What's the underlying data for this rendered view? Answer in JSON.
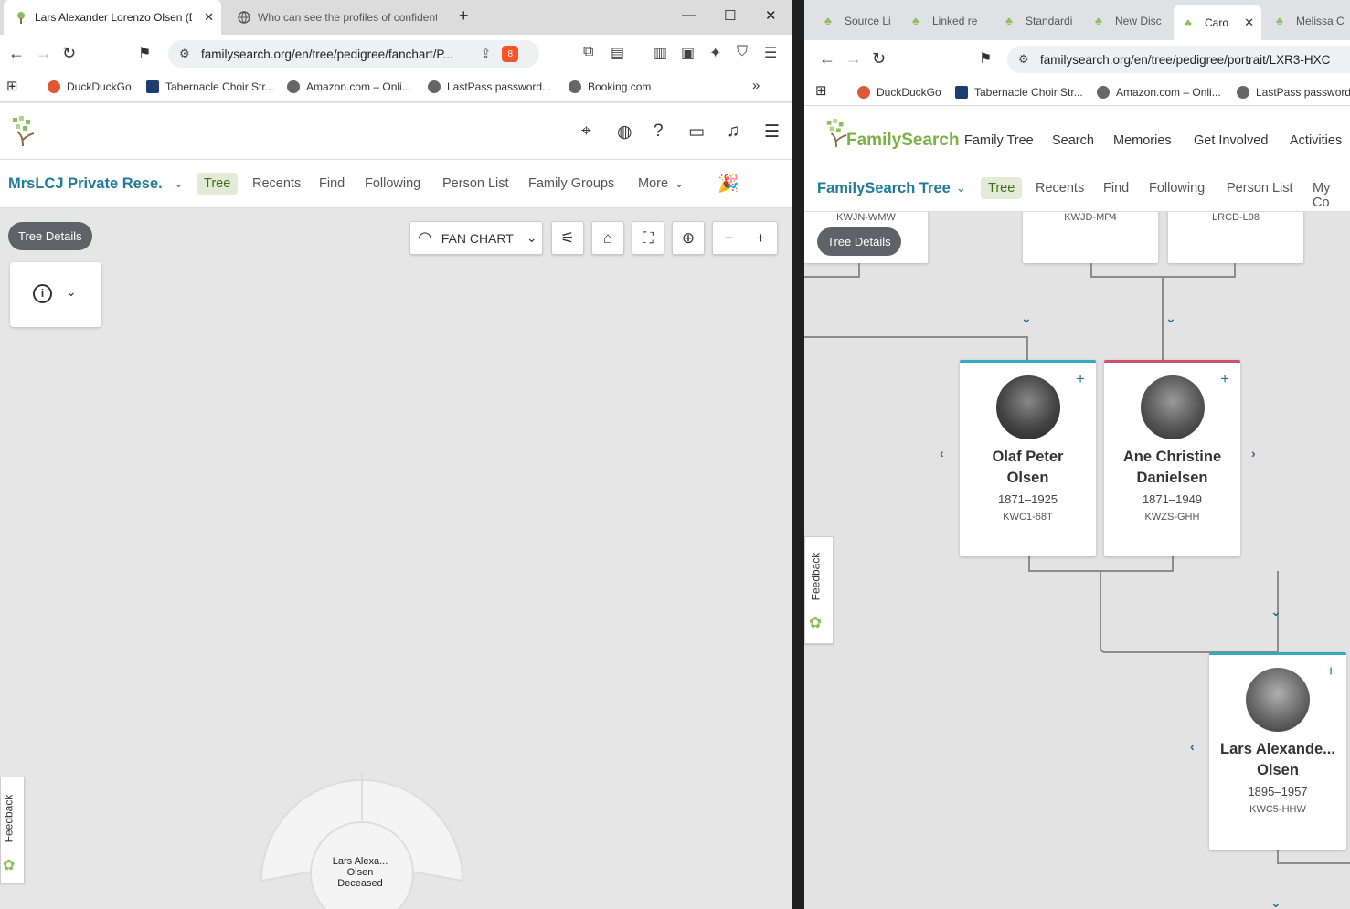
{
  "left": {
    "tabs": [
      {
        "label": "Lars Alexander Lorenzo Olsen (D",
        "active": true
      },
      {
        "label": "Who can see the profiles of confident",
        "active": false
      }
    ],
    "url": "familysearch.org/en/tree/pedigree/fanchart/P...",
    "brave_badge": "8",
    "bookmarks": [
      "DuckDuckGo",
      "Tabernacle Choir Str...",
      "Amazon.com – Onli...",
      "LastPass password...",
      "Booking.com"
    ],
    "tree_name": "MrsLCJ Private Rese...",
    "nav": [
      "Tree",
      "Recents",
      "Find",
      "Following",
      "Person List",
      "Family Groups",
      "More"
    ],
    "tree_details": "Tree Details",
    "chart_type": "FAN CHART",
    "fan_person": {
      "name": "Lars Alexa...",
      "surname": "Olsen",
      "status": "Deceased"
    },
    "feedback": "Feedback"
  },
  "right": {
    "tabs": [
      "Source Li",
      "Linked re",
      "Standardi",
      "New Disc",
      "Caro",
      "Melissa C"
    ],
    "url": "familysearch.org/en/tree/pedigree/portrait/LXR3-HXC",
    "bookmarks": [
      "DuckDuckGo",
      "Tabernacle Choir Str...",
      "Amazon.com – Onli...",
      "LastPass password..."
    ],
    "logo": "FamilySearch",
    "mainnav": [
      "Family Tree",
      "Search",
      "Memories",
      "Get Involved",
      "Activities"
    ],
    "tree_name": "FamilySearch Tree",
    "nav": [
      "Tree",
      "Recents",
      "Find",
      "Following",
      "Person List",
      "My Co"
    ],
    "tree_details": "Tree Details",
    "top_ids": [
      "KWJN-WMW",
      "KWJD-MP4",
      "LRCD-L98"
    ],
    "persons": [
      {
        "first": "Olaf Peter",
        "last": "Olsen",
        "years": "1871–1925",
        "id": "KWC1-68T",
        "gender_color": "#3aa6c6"
      },
      {
        "first": "Ane Christine",
        "last": "Danielsen",
        "years": "1871–1949",
        "id": "KWZS-GHH",
        "gender_color": "#d0506e"
      },
      {
        "first": "Lars Alexande...",
        "last": "Olsen",
        "years": "1895–1957",
        "id": "KWC5-HHW",
        "gender_color": "#3aa6c6"
      }
    ],
    "feedback": "Feedback"
  }
}
